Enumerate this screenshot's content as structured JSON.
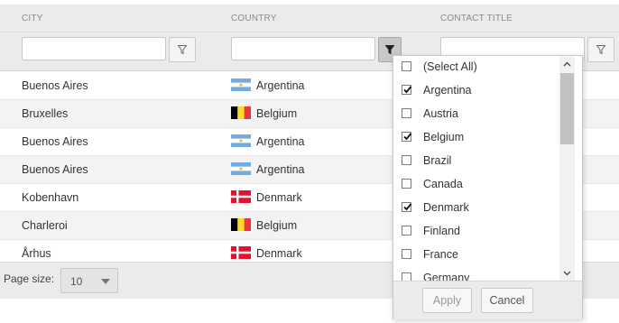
{
  "grid": {
    "columns": [
      {
        "header": "CITY"
      },
      {
        "header": "COUNTRY"
      },
      {
        "header": "CONTACT TITLE"
      }
    ],
    "filters": [
      "",
      "",
      ""
    ],
    "rows": [
      {
        "city": "Buenos Aires",
        "country": "Argentina",
        "flag": "argentina"
      },
      {
        "city": "Bruxelles",
        "country": "Belgium",
        "flag": "belgium"
      },
      {
        "city": "Buenos Aires",
        "country": "Argentina",
        "flag": "argentina"
      },
      {
        "city": "Buenos Aires",
        "country": "Argentina",
        "flag": "argentina"
      },
      {
        "city": "Kobenhavn",
        "country": "Denmark",
        "flag": "denmark"
      },
      {
        "city": "Charleroi",
        "country": "Belgium",
        "flag": "belgium"
      },
      {
        "city": "Århus",
        "country": "Denmark",
        "flag": "denmark"
      }
    ]
  },
  "pager": {
    "label": "Page size:",
    "value": "10"
  },
  "filter_popup": {
    "items": [
      {
        "label": "(Select All)",
        "checked": false
      },
      {
        "label": "Argentina",
        "checked": true
      },
      {
        "label": "Austria",
        "checked": false
      },
      {
        "label": "Belgium",
        "checked": true
      },
      {
        "label": "Brazil",
        "checked": false
      },
      {
        "label": "Canada",
        "checked": false
      },
      {
        "label": "Denmark",
        "checked": true
      },
      {
        "label": "Finland",
        "checked": false
      },
      {
        "label": "France",
        "checked": false
      },
      {
        "label": "Germany",
        "checked": false
      }
    ],
    "apply_label": "Apply",
    "cancel_label": "Cancel"
  },
  "colors": {
    "header_bg": "#ebebeb",
    "argentina_blue": "#74acdf",
    "belgium_black": "#000000",
    "belgium_yellow": "#fdda24",
    "belgium_red": "#ef3340",
    "denmark_red": "#e8112d"
  }
}
